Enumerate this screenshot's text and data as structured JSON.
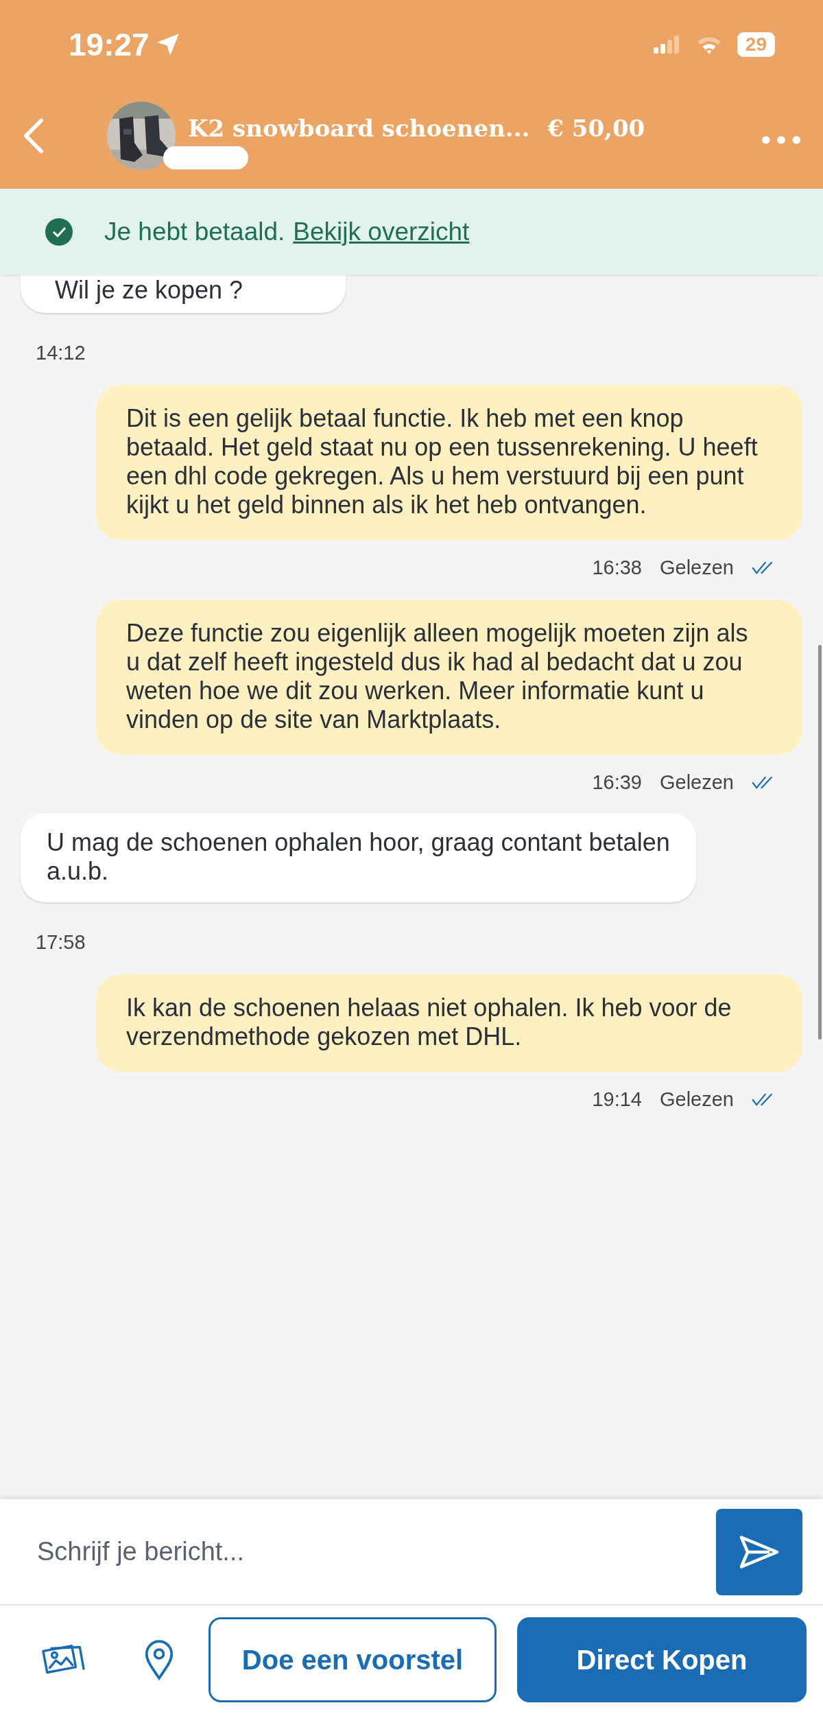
{
  "status_bar": {
    "time": "19:27",
    "battery": "29"
  },
  "header": {
    "title": "K2 snowboard schoenen...",
    "price": "€ 50,00"
  },
  "banner": {
    "text": "Je hebt betaald.",
    "link": "Bekijk overzicht"
  },
  "messages": [
    {
      "kind": "incoming",
      "text": "Wil je ze kopen ?",
      "partial": true
    },
    {
      "kind": "timestamp",
      "time": "14:12"
    },
    {
      "kind": "outgoing",
      "text": "Dit is een gelijk betaal functie. Ik heb met een knop betaald. Het geld staat nu op een tussenrekening. U heeft een dhl code gekregen. Als u hem verstuurd bij een punt kijkt u het geld binnen als ik het heb ontvangen.",
      "time": "16:38",
      "status": "Gelezen",
      "read": true
    },
    {
      "kind": "outgoing",
      "text": "Deze functie zou eigenlijk alleen mogelijk moeten zijn als u dat zelf heeft ingesteld dus ik had al bedacht dat u zou weten hoe we dit zou werken. Meer informatie kunt u vinden op de site van Marktplaats.",
      "time": "16:39",
      "status": "Gelezen",
      "read": true
    },
    {
      "kind": "incoming",
      "text": "U mag de schoenen ophalen hoor, graag contant betalen a.u.b.",
      "partial": false
    },
    {
      "kind": "timestamp",
      "time": "17:58"
    },
    {
      "kind": "outgoing",
      "text": "Ik kan de schoenen helaas niet ophalen. Ik heb voor de verzendmethode gekozen met DHL.",
      "time": "19:14",
      "status": "Gelezen",
      "read": true
    }
  ],
  "composer": {
    "placeholder": "Schrijf je bericht..."
  },
  "actions": [
    {
      "kind": "outline",
      "label": "Doe een voorstel"
    },
    {
      "kind": "primary",
      "label": "Direct Kopen"
    }
  ]
}
